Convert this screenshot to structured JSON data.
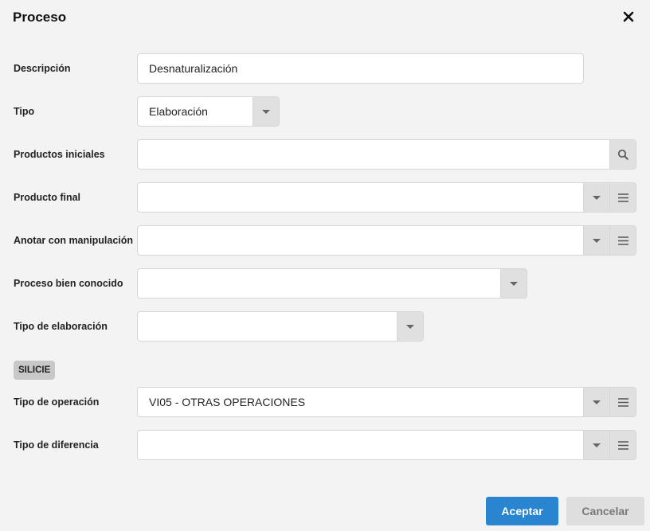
{
  "dialog": {
    "title": "Proceso"
  },
  "fields": {
    "descripcion": {
      "label": "Descripción",
      "value": "Desnaturalización"
    },
    "tipo": {
      "label": "Tipo",
      "value": "Elaboración"
    },
    "productos_iniciales": {
      "label": "Productos iniciales",
      "value": ""
    },
    "producto_final": {
      "label": "Producto final",
      "value": ""
    },
    "anotar_manipulacion": {
      "label": "Anotar con manipulación",
      "value": ""
    },
    "proceso_bien_conocido": {
      "label": "Proceso bien conocido",
      "value": ""
    },
    "tipo_elaboracion": {
      "label": "Tipo de elaboración",
      "value": ""
    }
  },
  "section": {
    "label": "SILICIE"
  },
  "silicie_fields": {
    "tipo_operacion": {
      "label": "Tipo de operación",
      "value": "VI05 - OTRAS OPERACIONES"
    },
    "tipo_diferencia": {
      "label": "Tipo de diferencia",
      "value": ""
    }
  },
  "buttons": {
    "accept": "Aceptar",
    "cancel": "Cancelar"
  },
  "colors": {
    "primary": "#2a85d0",
    "background": "#f3f3f3"
  }
}
